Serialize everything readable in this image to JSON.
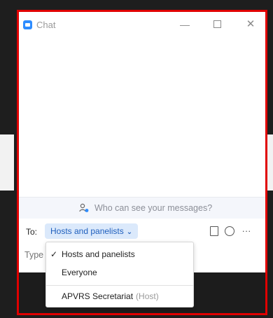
{
  "window": {
    "title": "Chat",
    "icon": "zoom-chat-icon",
    "controls": {
      "minimize": "—",
      "maximize": "□",
      "close": "✕"
    }
  },
  "chat": {
    "who_can_see": "Who can see your messages?"
  },
  "recipient": {
    "to_label": "To:",
    "selected": "Hosts and panelists"
  },
  "input": {
    "placeholder": "Type"
  },
  "toolbar": {
    "more_label": "···"
  },
  "dropdown": {
    "items": [
      {
        "label": "Hosts and panelists",
        "checked": true
      },
      {
        "label": "Everyone",
        "checked": false
      },
      {
        "label": "APVRS Secretariat",
        "role": "(Host)",
        "checked": false
      }
    ],
    "check_glyph": "✓"
  },
  "colors": {
    "accent": "#2d8cff",
    "select_bg": "#dbe9fb",
    "select_text": "#1f5fbd",
    "highlight_frame": "#e00000"
  }
}
